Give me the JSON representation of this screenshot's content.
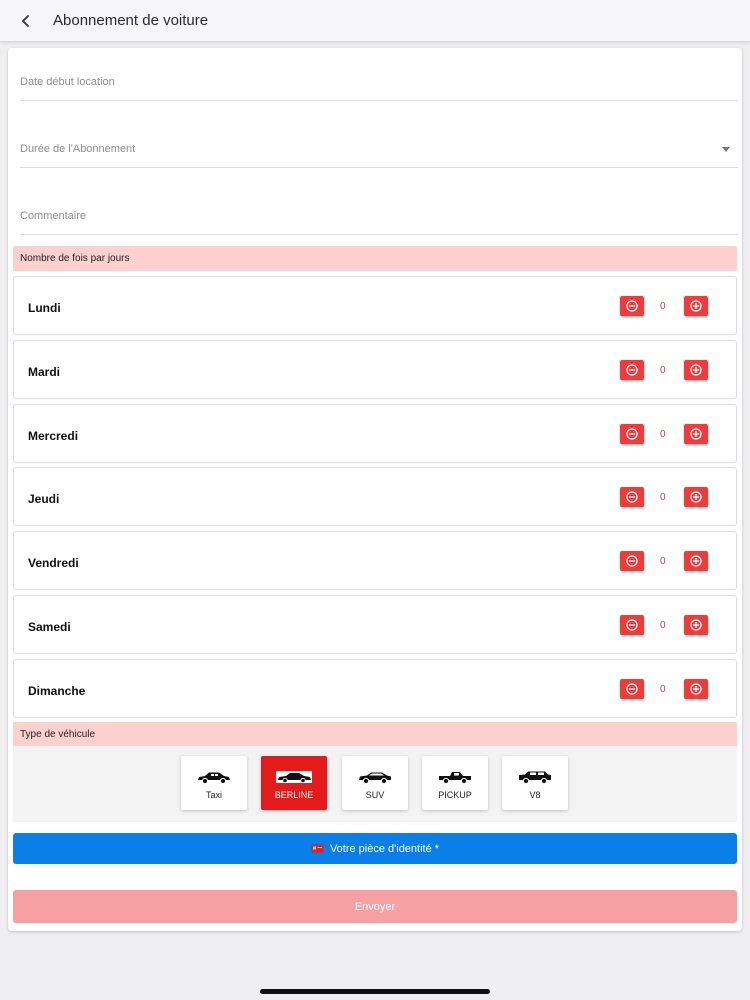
{
  "header": {
    "title": "Abonnement de voiture"
  },
  "form": {
    "start_date_label": "Date début location",
    "duration_label": "Durée de l'Abonnement",
    "comment_label": "Commentaire"
  },
  "times_per_day": {
    "section_title": "Nombre de fois par jours",
    "days": [
      {
        "name": "Lundi",
        "count": "0"
      },
      {
        "name": "Mardi",
        "count": "0"
      },
      {
        "name": "Mercredi",
        "count": "0"
      },
      {
        "name": "Jeudi",
        "count": "0"
      },
      {
        "name": "Vendredi",
        "count": "0"
      },
      {
        "name": "Samedi",
        "count": "0"
      },
      {
        "name": "Dimanche",
        "count": "0"
      }
    ]
  },
  "vehicle_type": {
    "section_title": "Type de véhicule",
    "options": [
      {
        "label": "Taxi",
        "icon": "taxi-icon",
        "selected": false
      },
      {
        "label": "BERLINE",
        "icon": "sedan-icon",
        "selected": true
      },
      {
        "label": "SUV",
        "icon": "suv-icon",
        "selected": false
      },
      {
        "label": "PICKUP",
        "icon": "pickup-icon",
        "selected": false
      },
      {
        "label": "V8",
        "icon": "v8-icon",
        "selected": false
      }
    ]
  },
  "buttons": {
    "id_document_label": "Votre pièce d'identité *",
    "send_label": "Envoyer"
  },
  "colors": {
    "accent_red": "#ef3b3b",
    "selected_red": "#e51a1a",
    "section_pink": "#fdd0d0",
    "primary_blue": "#0a7fe8",
    "send_pink": "#f6a0a4"
  }
}
